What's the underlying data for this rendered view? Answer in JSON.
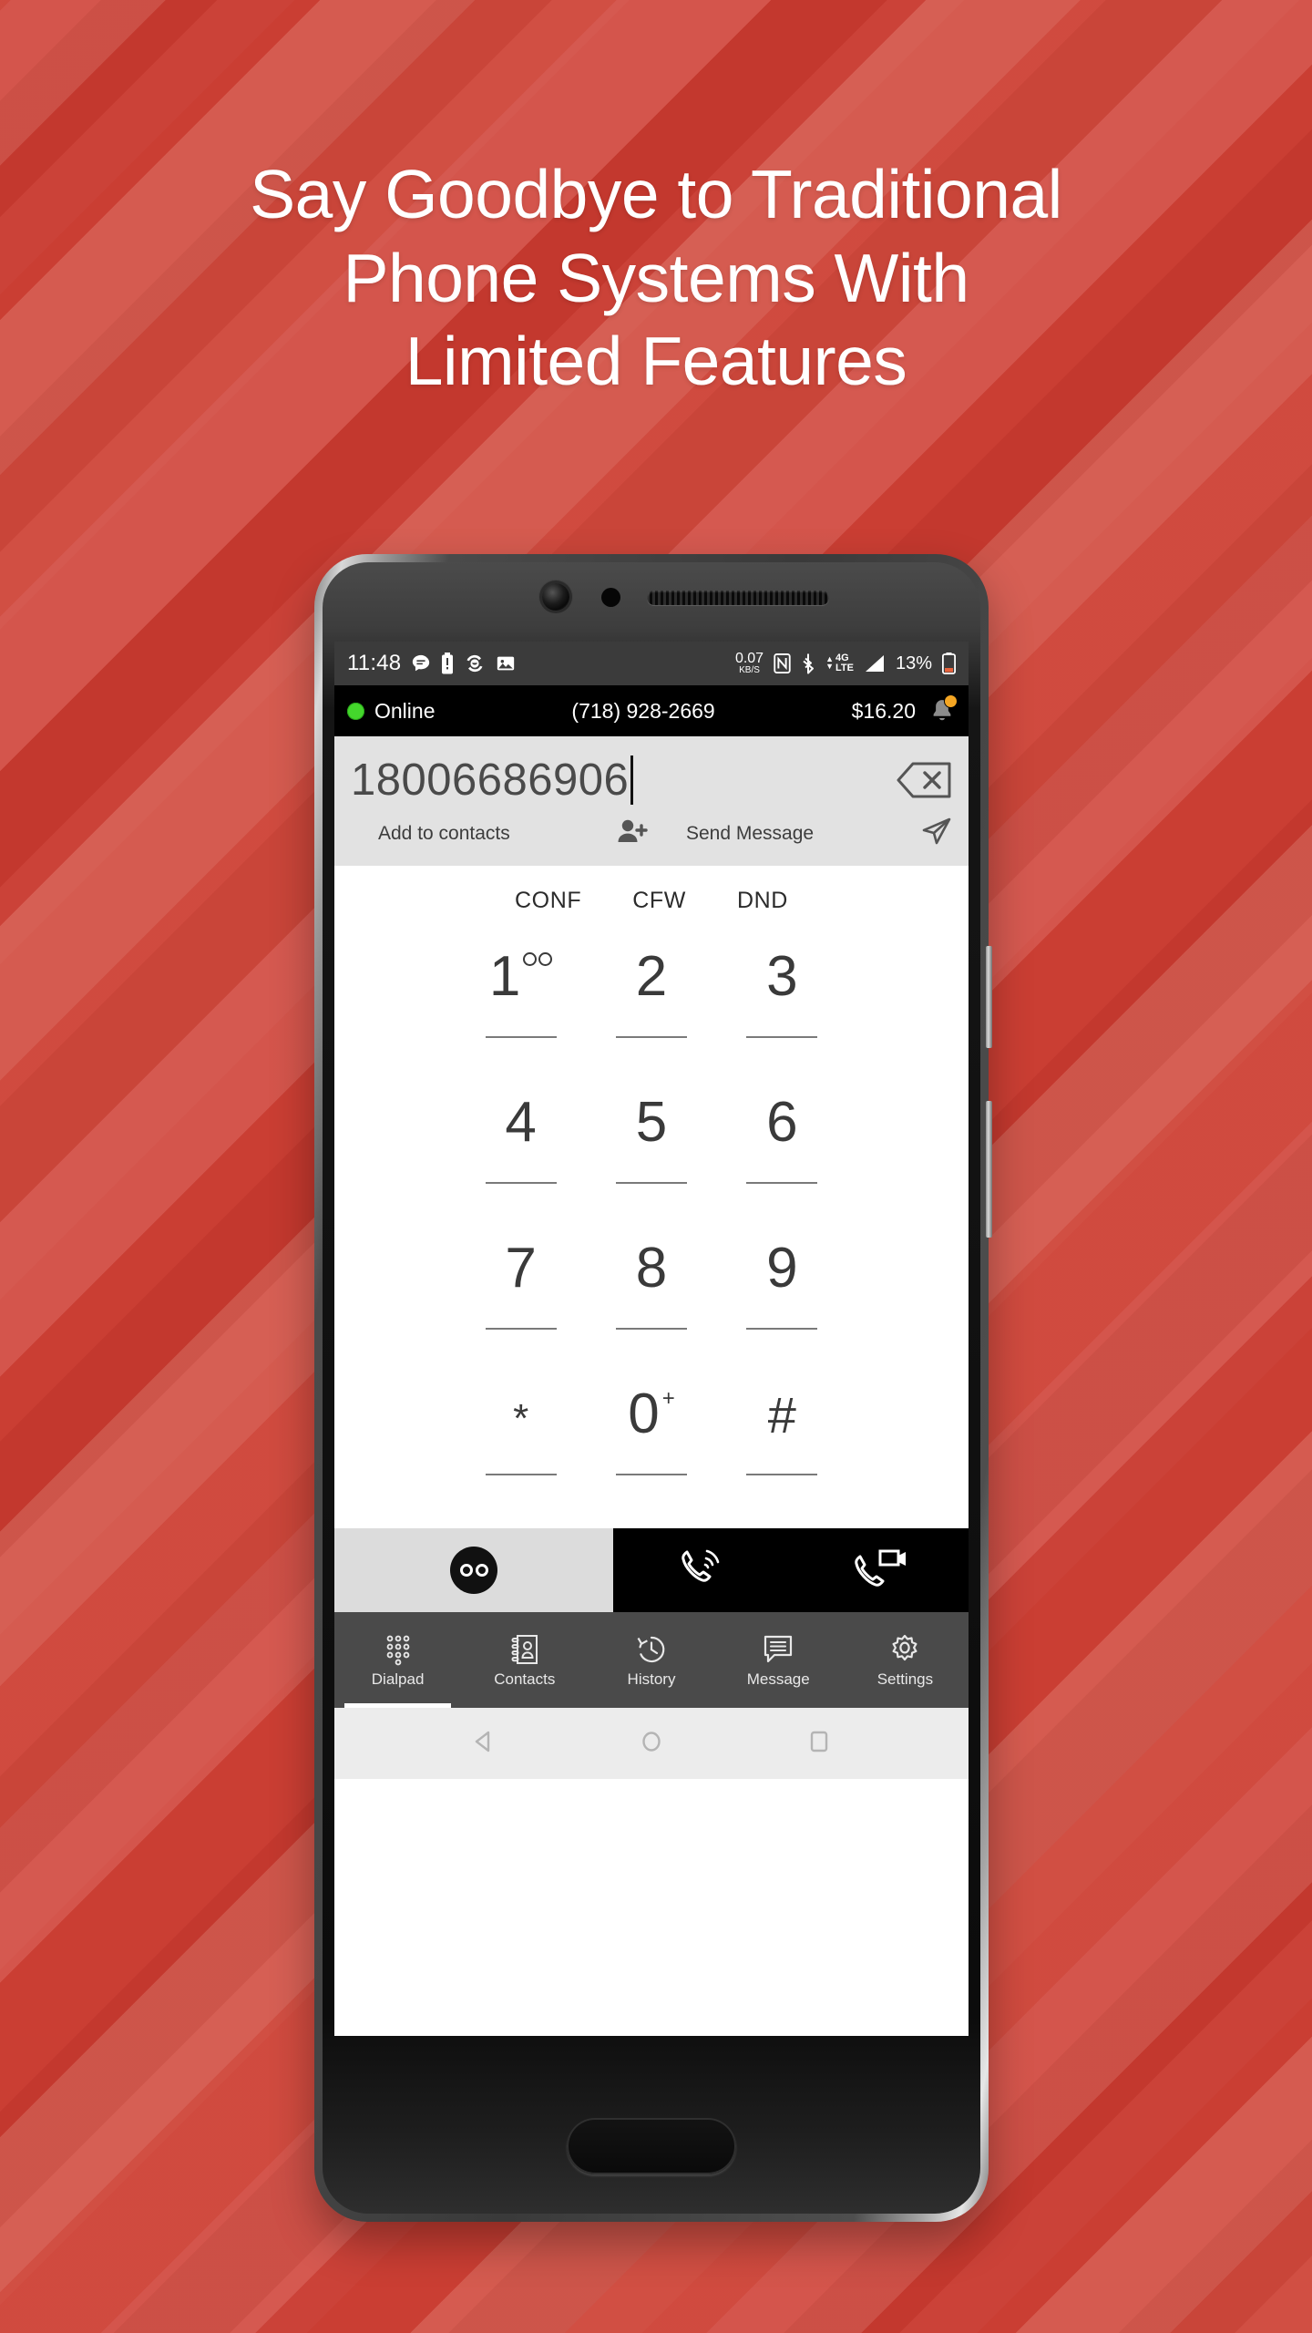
{
  "headline": {
    "line1": "Say Goodbye to Traditional",
    "line2": "Phone Systems With",
    "line3": "Limited Features"
  },
  "colors": {
    "background_red": "#CB4034",
    "background_red_light": "#D4584C",
    "app_bar": "#000000",
    "online_dot": "#44D62C",
    "badge_orange": "#F5A623",
    "nav_bar": "#4A4A4A",
    "status_bar": "#3B3B3B"
  },
  "status_bar": {
    "clock": "11:48",
    "left_icons": [
      "message-icon",
      "battery-saver-icon",
      "sync-icon",
      "gallery-icon"
    ],
    "net_speed_value": "0.07",
    "net_speed_unit": "KB/S",
    "right_icons": [
      "nfc-icon",
      "bluetooth-icon",
      "signal-bars-icon",
      "battery-icon"
    ],
    "network_type": "4G",
    "network_type_sub": "LTE",
    "battery_percent": "13%"
  },
  "app_bar": {
    "status_label": "Online",
    "phone_number": "(718) 928-2669",
    "balance": "$16.20",
    "bell_icon": "bell-icon"
  },
  "dialer": {
    "dialed_number": "18006686906",
    "backspace_icon": "backspace-icon",
    "add_to_contacts_label": "Add to contacts",
    "add_to_contacts_icon": "person-add-icon",
    "send_message_label": "Send Message",
    "send_message_icon": "send-icon"
  },
  "features": [
    {
      "label": "CONF"
    },
    {
      "label": "CFW"
    },
    {
      "label": "DND"
    }
  ],
  "keypad": [
    {
      "digit": "1",
      "sup": "",
      "voicemail": true
    },
    {
      "digit": "2",
      "sup": ""
    },
    {
      "digit": "3",
      "sup": ""
    },
    {
      "digit": "4",
      "sup": ""
    },
    {
      "digit": "5",
      "sup": ""
    },
    {
      "digit": "6",
      "sup": ""
    },
    {
      "digit": "7",
      "sup": ""
    },
    {
      "digit": "8",
      "sup": ""
    },
    {
      "digit": "9",
      "sup": ""
    },
    {
      "digit": "*",
      "sup": ""
    },
    {
      "digit": "0",
      "sup": "+"
    },
    {
      "digit": "#",
      "sup": ""
    }
  ],
  "call_bar": {
    "voicemail_icon": "voicemail-icon",
    "call_icon": "call-icon",
    "video_call_icon": "video-call-icon"
  },
  "bottom_nav": [
    {
      "label": "Dialpad",
      "icon": "dialpad-icon",
      "active": true
    },
    {
      "label": "Contacts",
      "icon": "contacts-book-icon",
      "active": false
    },
    {
      "label": "History",
      "icon": "history-clock-icon",
      "active": false
    },
    {
      "label": "Message",
      "icon": "message-bubble-icon",
      "active": false
    },
    {
      "label": "Settings",
      "icon": "gear-icon",
      "active": false
    }
  ],
  "android_nav": [
    {
      "icon": "back-triangle-icon"
    },
    {
      "icon": "home-circle-icon"
    },
    {
      "icon": "recents-square-icon"
    }
  ],
  "device": {
    "front_camera_icon": "front-camera-icon",
    "proximity_sensor_icon": "proximity-sensor-icon",
    "earpiece_icon": "earpiece-speaker-icon",
    "home_button_icon": "home-button"
  }
}
